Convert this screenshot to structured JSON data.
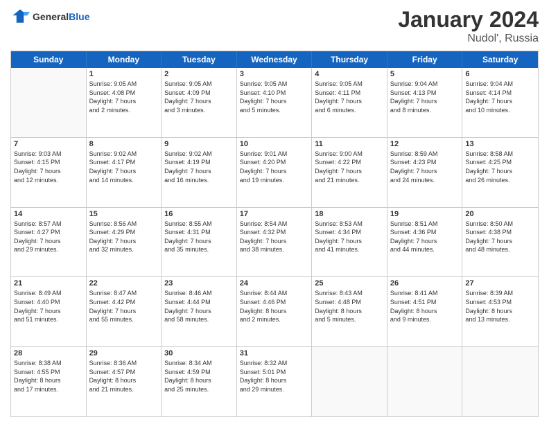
{
  "header": {
    "logo_general": "General",
    "logo_blue": "Blue",
    "title": "January 2024",
    "location": "Nudol', Russia"
  },
  "weekdays": [
    "Sunday",
    "Monday",
    "Tuesday",
    "Wednesday",
    "Thursday",
    "Friday",
    "Saturday"
  ],
  "weeks": [
    [
      {
        "day": "",
        "info": ""
      },
      {
        "day": "1",
        "info": "Sunrise: 9:05 AM\nSunset: 4:08 PM\nDaylight: 7 hours\nand 2 minutes."
      },
      {
        "day": "2",
        "info": "Sunrise: 9:05 AM\nSunset: 4:09 PM\nDaylight: 7 hours\nand 3 minutes."
      },
      {
        "day": "3",
        "info": "Sunrise: 9:05 AM\nSunset: 4:10 PM\nDaylight: 7 hours\nand 5 minutes."
      },
      {
        "day": "4",
        "info": "Sunrise: 9:05 AM\nSunset: 4:11 PM\nDaylight: 7 hours\nand 6 minutes."
      },
      {
        "day": "5",
        "info": "Sunrise: 9:04 AM\nSunset: 4:13 PM\nDaylight: 7 hours\nand 8 minutes."
      },
      {
        "day": "6",
        "info": "Sunrise: 9:04 AM\nSunset: 4:14 PM\nDaylight: 7 hours\nand 10 minutes."
      }
    ],
    [
      {
        "day": "7",
        "info": "Sunrise: 9:03 AM\nSunset: 4:15 PM\nDaylight: 7 hours\nand 12 minutes."
      },
      {
        "day": "8",
        "info": "Sunrise: 9:02 AM\nSunset: 4:17 PM\nDaylight: 7 hours\nand 14 minutes."
      },
      {
        "day": "9",
        "info": "Sunrise: 9:02 AM\nSunset: 4:19 PM\nDaylight: 7 hours\nand 16 minutes."
      },
      {
        "day": "10",
        "info": "Sunrise: 9:01 AM\nSunset: 4:20 PM\nDaylight: 7 hours\nand 19 minutes."
      },
      {
        "day": "11",
        "info": "Sunrise: 9:00 AM\nSunset: 4:22 PM\nDaylight: 7 hours\nand 21 minutes."
      },
      {
        "day": "12",
        "info": "Sunrise: 8:59 AM\nSunset: 4:23 PM\nDaylight: 7 hours\nand 24 minutes."
      },
      {
        "day": "13",
        "info": "Sunrise: 8:58 AM\nSunset: 4:25 PM\nDaylight: 7 hours\nand 26 minutes."
      }
    ],
    [
      {
        "day": "14",
        "info": "Sunrise: 8:57 AM\nSunset: 4:27 PM\nDaylight: 7 hours\nand 29 minutes."
      },
      {
        "day": "15",
        "info": "Sunrise: 8:56 AM\nSunset: 4:29 PM\nDaylight: 7 hours\nand 32 minutes."
      },
      {
        "day": "16",
        "info": "Sunrise: 8:55 AM\nSunset: 4:31 PM\nDaylight: 7 hours\nand 35 minutes."
      },
      {
        "day": "17",
        "info": "Sunrise: 8:54 AM\nSunset: 4:32 PM\nDaylight: 7 hours\nand 38 minutes."
      },
      {
        "day": "18",
        "info": "Sunrise: 8:53 AM\nSunset: 4:34 PM\nDaylight: 7 hours\nand 41 minutes."
      },
      {
        "day": "19",
        "info": "Sunrise: 8:51 AM\nSunset: 4:36 PM\nDaylight: 7 hours\nand 44 minutes."
      },
      {
        "day": "20",
        "info": "Sunrise: 8:50 AM\nSunset: 4:38 PM\nDaylight: 7 hours\nand 48 minutes."
      }
    ],
    [
      {
        "day": "21",
        "info": "Sunrise: 8:49 AM\nSunset: 4:40 PM\nDaylight: 7 hours\nand 51 minutes."
      },
      {
        "day": "22",
        "info": "Sunrise: 8:47 AM\nSunset: 4:42 PM\nDaylight: 7 hours\nand 55 minutes."
      },
      {
        "day": "23",
        "info": "Sunrise: 8:46 AM\nSunset: 4:44 PM\nDaylight: 7 hours\nand 58 minutes."
      },
      {
        "day": "24",
        "info": "Sunrise: 8:44 AM\nSunset: 4:46 PM\nDaylight: 8 hours\nand 2 minutes."
      },
      {
        "day": "25",
        "info": "Sunrise: 8:43 AM\nSunset: 4:48 PM\nDaylight: 8 hours\nand 5 minutes."
      },
      {
        "day": "26",
        "info": "Sunrise: 8:41 AM\nSunset: 4:51 PM\nDaylight: 8 hours\nand 9 minutes."
      },
      {
        "day": "27",
        "info": "Sunrise: 8:39 AM\nSunset: 4:53 PM\nDaylight: 8 hours\nand 13 minutes."
      }
    ],
    [
      {
        "day": "28",
        "info": "Sunrise: 8:38 AM\nSunset: 4:55 PM\nDaylight: 8 hours\nand 17 minutes."
      },
      {
        "day": "29",
        "info": "Sunrise: 8:36 AM\nSunset: 4:57 PM\nDaylight: 8 hours\nand 21 minutes."
      },
      {
        "day": "30",
        "info": "Sunrise: 8:34 AM\nSunset: 4:59 PM\nDaylight: 8 hours\nand 25 minutes."
      },
      {
        "day": "31",
        "info": "Sunrise: 8:32 AM\nSunset: 5:01 PM\nDaylight: 8 hours\nand 29 minutes."
      },
      {
        "day": "",
        "info": ""
      },
      {
        "day": "",
        "info": ""
      },
      {
        "day": "",
        "info": ""
      }
    ]
  ]
}
